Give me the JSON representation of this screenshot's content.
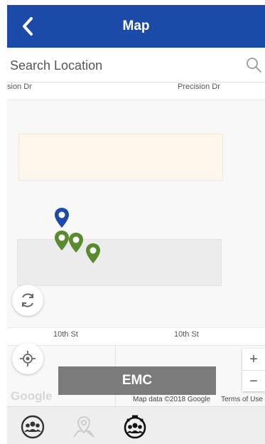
{
  "header": {
    "title": "Map",
    "back_icon": "chevron-left-icon",
    "background_color": "#1c4aa8"
  },
  "search": {
    "placeholder": "Search Location",
    "icon": "search-icon"
  },
  "map": {
    "road_labels": {
      "top_left": "sion Dr",
      "top_right": "Precision Dr",
      "bottom_left": "10th St",
      "bottom_right": "10th St"
    },
    "markers": [
      {
        "type": "pin",
        "color": "#1c4aa8"
      },
      {
        "type": "pin",
        "color": "#5a8a2e"
      },
      {
        "type": "pin",
        "color": "#5a8a2e"
      },
      {
        "type": "pin",
        "color": "#5a8a2e"
      }
    ],
    "refresh_icon": "refresh-icon",
    "locate_icon": "my-location-icon",
    "zoom_in_label": "+",
    "zoom_out_label": "−",
    "google_logo": "Google",
    "attribution": "Map data ©2018 Google",
    "terms_label": "Terms of Use"
  },
  "emc_button": {
    "label": "EMC"
  },
  "tabbar": {
    "tabs": [
      {
        "icon": "group-icon",
        "active": false
      },
      {
        "icon": "map-pin-icon",
        "active": false
      },
      {
        "icon": "alarm-group-icon",
        "active": true
      }
    ]
  }
}
